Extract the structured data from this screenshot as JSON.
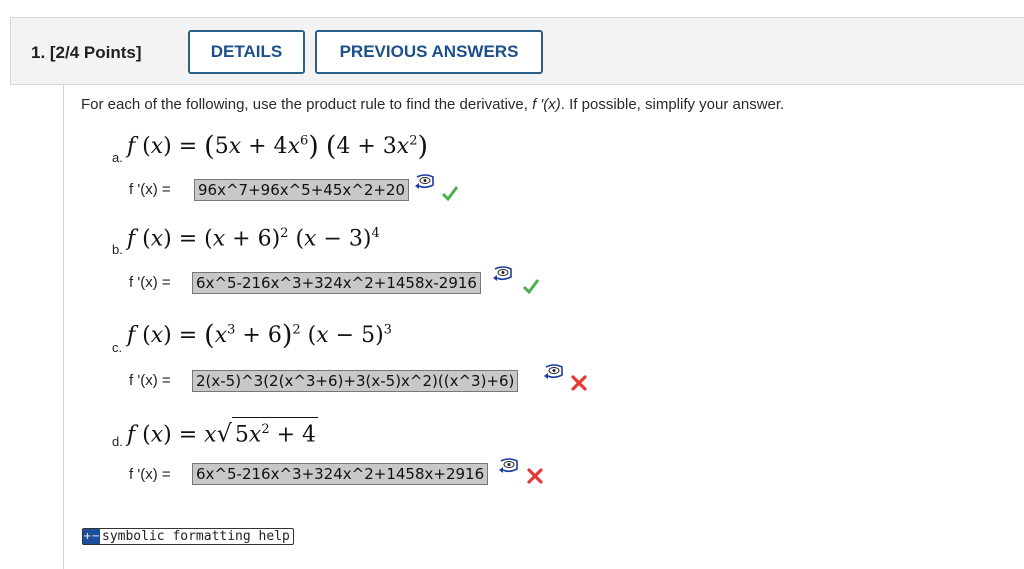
{
  "question": {
    "title": "1.  [2/4 Points]",
    "details_label": "DETAILS",
    "previous_answers_label": "PREVIOUS ANSWERS"
  },
  "instructions": {
    "before": "For each of the following, use the product rule to find the derivative, ",
    "fprime": "f '(x)",
    "after": ". If possible, simplify your answer."
  },
  "parts": [
    {
      "label": "a.",
      "answer_label": "f '(x) = ",
      "answer": "96x^7+96x^5+45x^2+20",
      "status": "correct"
    },
    {
      "label": "b.",
      "answer_label": "f '(x) = ",
      "answer": "6x^5-216x^3+324x^2+1458x-2916",
      "status": "correct"
    },
    {
      "label": "c.",
      "answer_label": "f '(x) = ",
      "answer": "2(x-5)^3(2(x^3+6)+3(x-5)x^2)((x^3)+6)",
      "status": "incorrect"
    },
    {
      "label": "d.",
      "answer_label": "f '(x) = ",
      "answer": "6x^5-216x^3+324x^2+1458x+2916",
      "status": "incorrect"
    }
  ],
  "help": {
    "label": "symbolic formatting help"
  },
  "colors": {
    "correct": "#4caf50",
    "incorrect": "#e53935",
    "button_border": "#2c5f83",
    "button_text": "#1d4f8a",
    "answer_bg": "#c8c8c8"
  }
}
